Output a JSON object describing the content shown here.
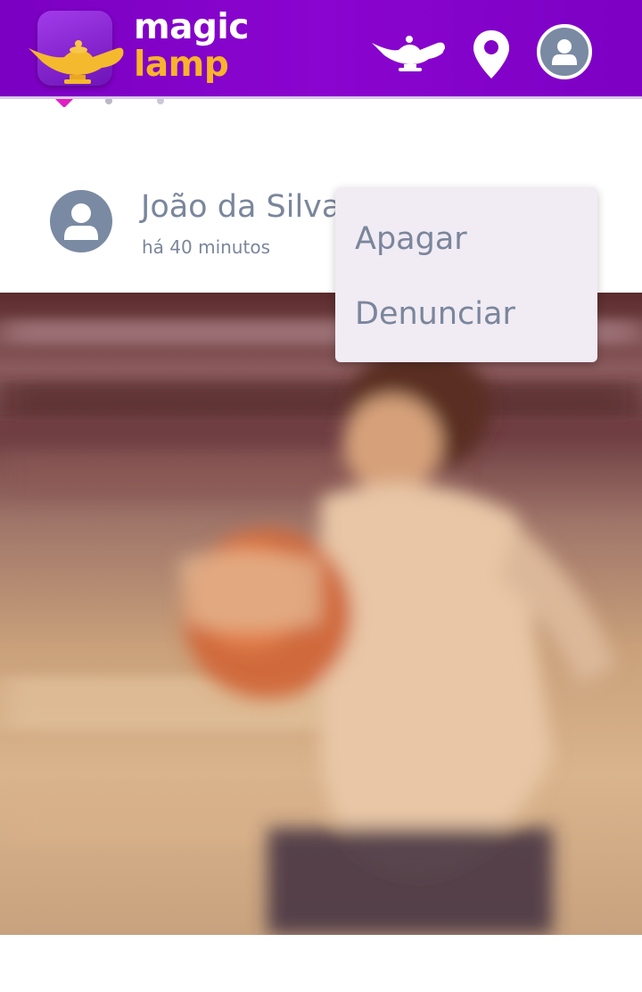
{
  "header": {
    "brand_line1": "magic",
    "brand_line2": "lamp",
    "colors": {
      "bar": "#8200c6",
      "brand_accent": "#f8b32b",
      "lamp_gold": "#f5b92d"
    },
    "icons": [
      "lamp-icon",
      "location-pin-icon",
      "user-avatar-icon"
    ]
  },
  "post": {
    "author": "João da Silva",
    "time": "há 40 minutos"
  },
  "menu": {
    "items": [
      "Apagar",
      "Denunciar"
    ]
  }
}
